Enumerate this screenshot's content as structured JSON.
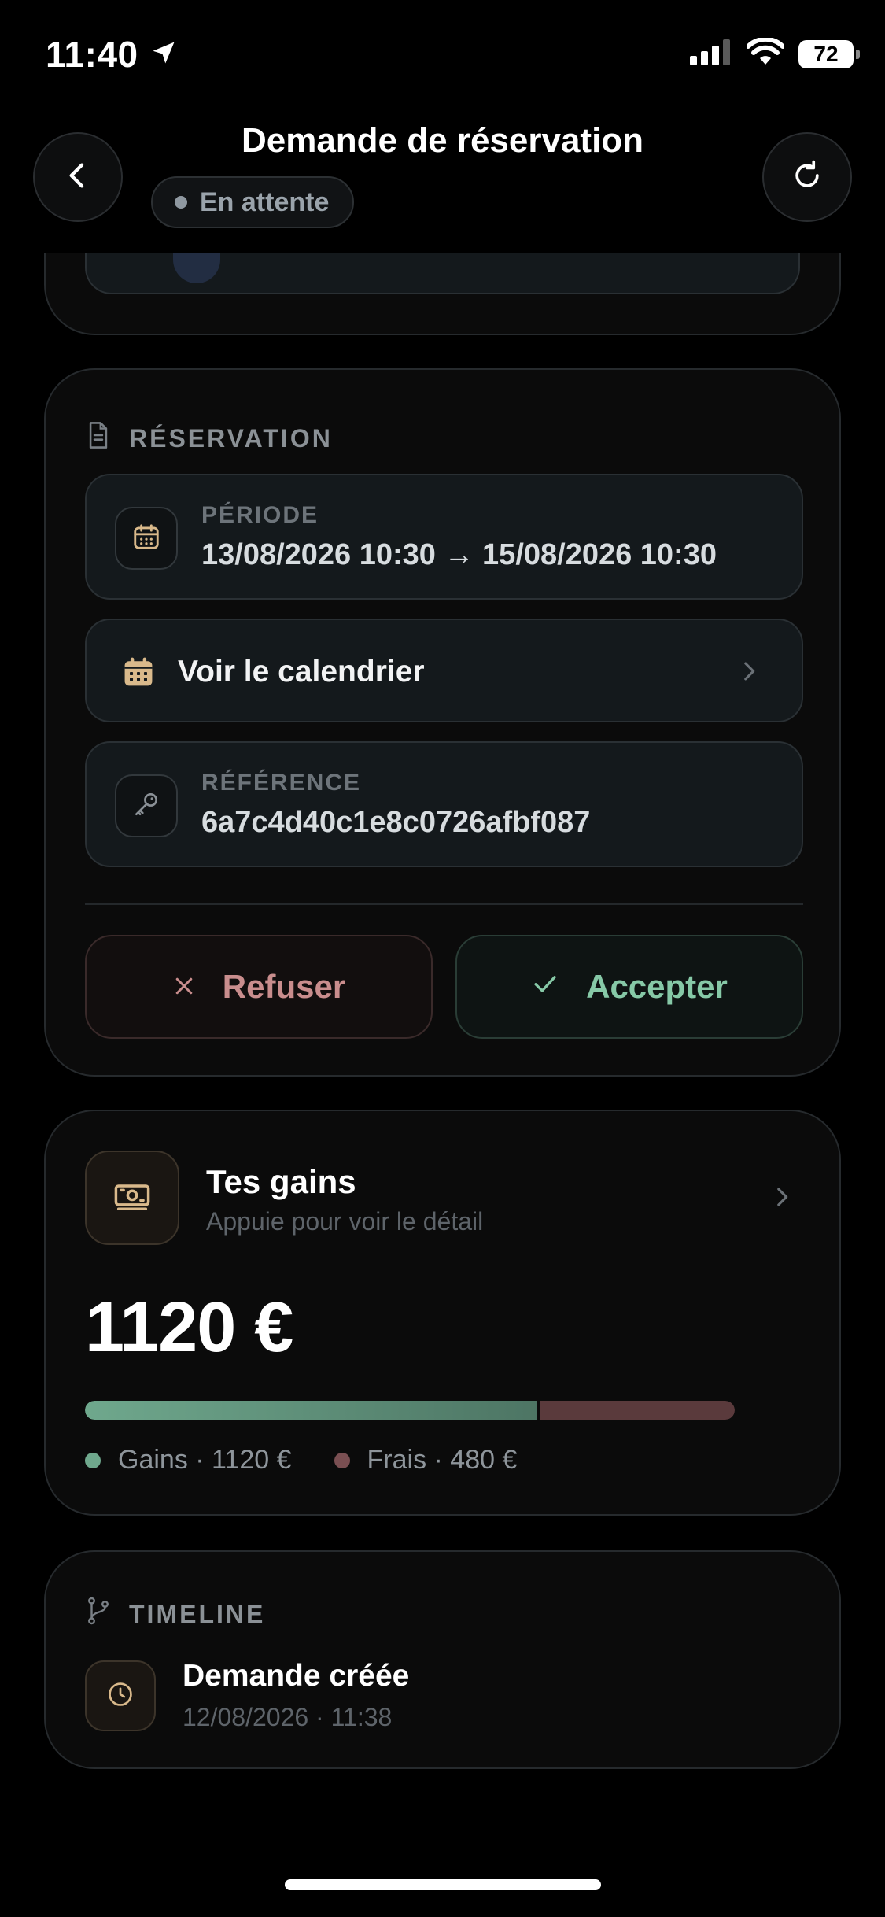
{
  "status_bar": {
    "time": "11:40",
    "battery": "72"
  },
  "header": {
    "title": "Demande de réservation",
    "status": "En attente"
  },
  "reservation": {
    "section_title": "RÉSERVATION",
    "period_label": "PÉRIODE",
    "period_value": "13/08/2026 10:30 → 15/08/2026 10:30",
    "calendar_label": "Voir le calendrier",
    "reference_label": "RÉFÉRENCE",
    "reference_value": "6a7c4d40c1e8c0726afbf087",
    "refuse_label": "Refuser",
    "accept_label": "Accepter"
  },
  "gains": {
    "title": "Tes gains",
    "subtitle": "Appuie pour voir le détail",
    "amount": "1120 €",
    "gains_value": 1120,
    "fees_value": 480,
    "legend_gains": "Gains · 1120 €",
    "legend_fees": "Frais · 480 €"
  },
  "timeline": {
    "section_title": "TIMELINE",
    "event_title": "Demande créée",
    "event_date": "12/08/2026 · 11:38"
  },
  "colors": {
    "gains": "#6fa88d",
    "fees": "#5a3a3c",
    "accent_gold": "#d9b98b",
    "accept": "#86c9a7",
    "refuse": "#c98d8d"
  }
}
